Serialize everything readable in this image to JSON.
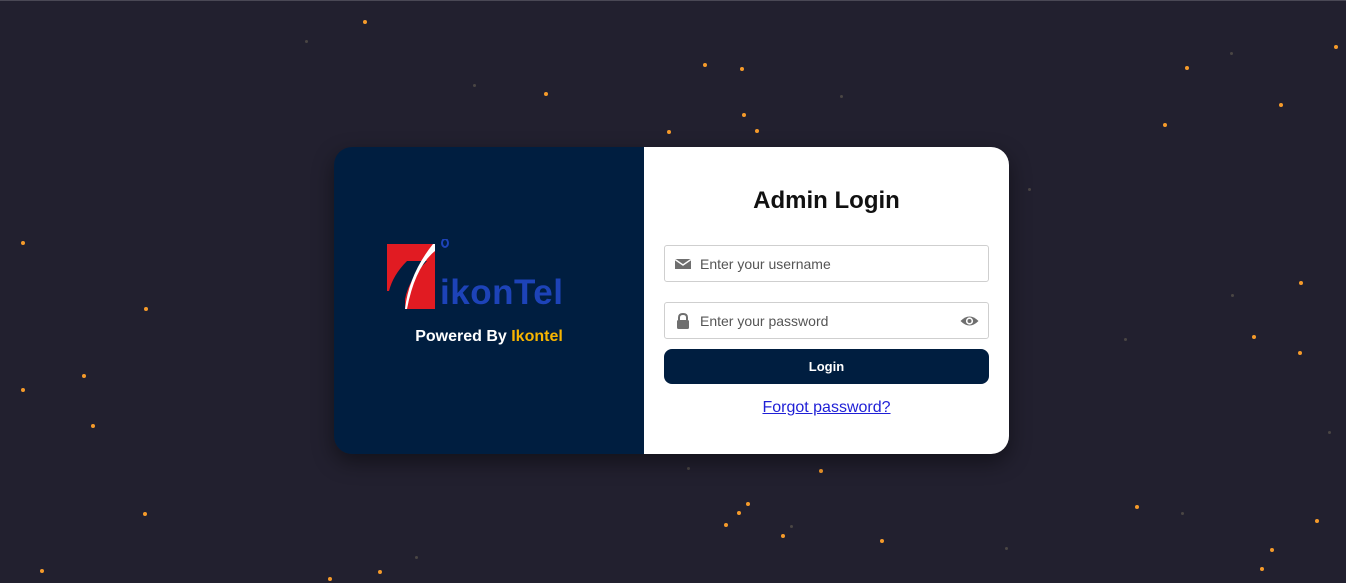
{
  "brand": {
    "logo_text": "ikonTel",
    "powered_prefix": "Powered By",
    "powered_name": "Ikontel"
  },
  "form": {
    "title": "Admin Login",
    "username_placeholder": "Enter your username",
    "password_placeholder": "Enter your password",
    "login_label": "Login",
    "forgot_label": "Forgot password?"
  },
  "colors": {
    "background": "#22202f",
    "panel": "#001e40",
    "accent": "#f7b500",
    "logo_red": "#e11b22",
    "logo_blue": "#1d43b8",
    "star": "#f59a2a"
  },
  "icons": {
    "username": "envelope-icon",
    "password": "lock-icon",
    "toggle": "eye-icon"
  }
}
